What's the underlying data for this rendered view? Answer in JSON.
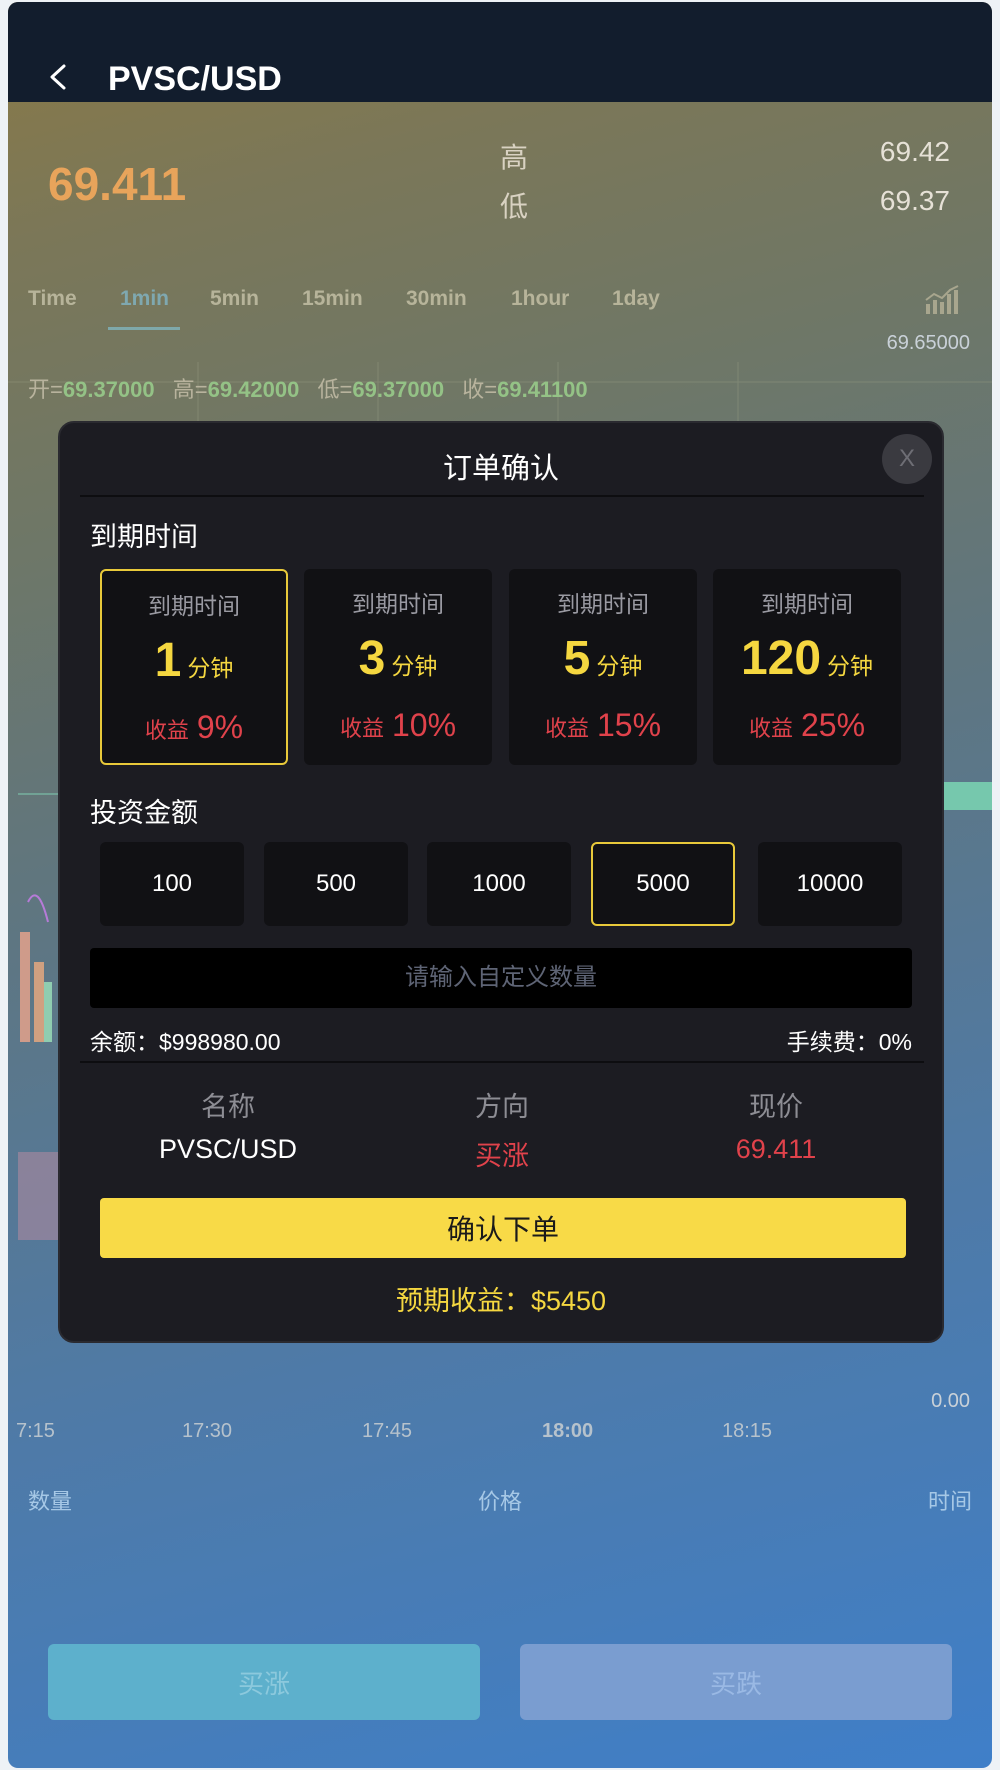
{
  "header": {
    "title": "PVSC/USD"
  },
  "quote": {
    "price": "69.411",
    "high_label": "高",
    "high": "69.42",
    "low_label": "低",
    "low": "69.37"
  },
  "tabs": [
    "Time",
    "1min",
    "5min",
    "15min",
    "30min",
    "1hour",
    "1day"
  ],
  "active_tab": "1min",
  "ohlc": {
    "open_label": "开=",
    "open": "69.37000",
    "high_label": "高=",
    "high": "69.42000",
    "low_label": "低=",
    "low": "69.37000",
    "close_label": "收=",
    "close": "69.41100"
  },
  "chart_axis": {
    "top_price": "69.65000",
    "bottom_vol": "0.00",
    "times": [
      "7:15",
      "17:30",
      "17:45",
      "18:00",
      "18:15"
    ]
  },
  "trade_table": {
    "qty": "数量",
    "price": "价格",
    "time": "时间"
  },
  "bottom_buttons": {
    "buy_up": "买涨",
    "buy_down": "买跌"
  },
  "modal": {
    "title": "订单确认",
    "close": "X",
    "expiry_section": "到期时间",
    "expiry_options": [
      {
        "label": "到期时间",
        "value": "1",
        "unit": "分钟",
        "yield_label": "收益",
        "yield": "9%",
        "selected": true
      },
      {
        "label": "到期时间",
        "value": "3",
        "unit": "分钟",
        "yield_label": "收益",
        "yield": "10%",
        "selected": false
      },
      {
        "label": "到期时间",
        "value": "5",
        "unit": "分钟",
        "yield_label": "收益",
        "yield": "15%",
        "selected": false
      },
      {
        "label": "到期时间",
        "value": "120",
        "unit": "分钟",
        "yield_label": "收益",
        "yield": "25%",
        "selected": false
      }
    ],
    "amount_section": "投资金额",
    "amounts": [
      "100",
      "500",
      "1000",
      "5000",
      "10000"
    ],
    "selected_amount": "5000",
    "custom_placeholder": "请输入自定义数量",
    "balance": "余额：$998980.00",
    "fee": "手续费：0%",
    "info": {
      "name_label": "名称",
      "name": "PVSC/USD",
      "direction_label": "方向",
      "direction": "买涨",
      "price_label": "现价",
      "price": "69.411"
    },
    "confirm": "确认下单",
    "expected": "预期收益：$5450"
  },
  "colors": {
    "accent_yellow": "#f8da47",
    "loss_red": "#e0424b",
    "price_orange": "#e8a45b"
  }
}
